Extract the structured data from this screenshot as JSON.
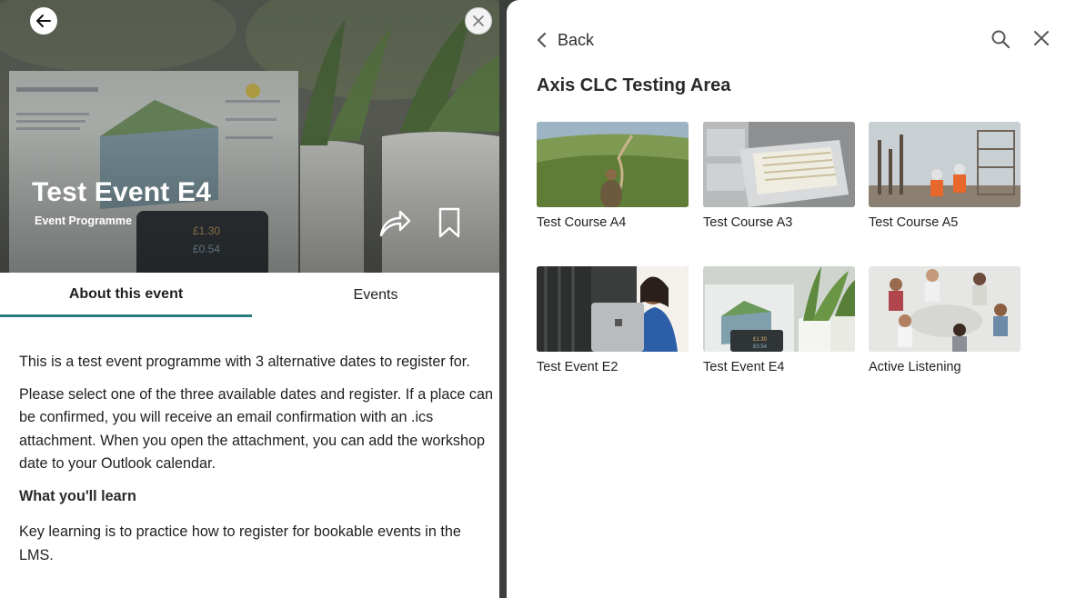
{
  "event": {
    "title": "Test Event E4",
    "subtitle": "Event Programme",
    "tabs": [
      {
        "label": "About this event",
        "active": true
      },
      {
        "label": "Events",
        "active": false
      }
    ],
    "description": [
      "This is a test event programme with 3 alternative dates to register for.",
      "Please select one of the three available dates and register. If a place can be confirmed, you will receive an email confirmation with an .ics attachment. When you open the attachment, you can add the workshop date to your Outlook calendar."
    ],
    "learn_heading": "What you'll learn",
    "learn_text": "Key learning is to practice how to register for bookable events in the LMS.",
    "hero_icons": [
      "back-arrow-icon",
      "close-icon",
      "share-icon",
      "bookmark-icon"
    ]
  },
  "panel": {
    "back_label": "Back",
    "title": "Axis CLC Testing Area",
    "icons": [
      "chevron-left-icon",
      "search-icon",
      "close-icon"
    ],
    "courses": [
      {
        "label": "Test Course A4",
        "image": "hiker on green hills"
      },
      {
        "label": "Test Course A3",
        "image": "open filing cabinet drawer"
      },
      {
        "label": "Test Course A5",
        "image": "construction workers on site"
      },
      {
        "label": "Test Event E2",
        "image": "woman with laptop"
      },
      {
        "label": "Test Event E4",
        "image": "energy meter and plants"
      },
      {
        "label": "Active Listening",
        "image": "group discussion in circle"
      }
    ]
  },
  "colors": {
    "accent": "#2a7b80",
    "text": "#1f1f1f",
    "backdrop": "#3b3e3b"
  }
}
